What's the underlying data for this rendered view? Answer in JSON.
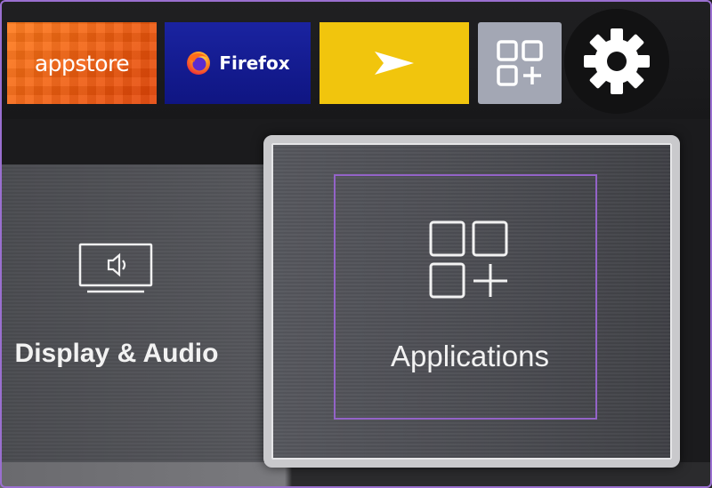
{
  "top_row": {
    "tiles": [
      {
        "label": "appstore",
        "icon": "appstore-logo"
      },
      {
        "label": "Firefox",
        "icon": "firefox-icon"
      },
      {
        "label": "",
        "icon": "send-arrow-icon"
      },
      {
        "label": "",
        "icon": "apps-grid-plus-icon"
      }
    ],
    "settings_icon": "gear-icon"
  },
  "settings": {
    "items": [
      {
        "label": "Display & Audio",
        "icon": "display-speaker-icon"
      },
      {
        "label": "Applications",
        "icon": "apps-grid-plus-icon"
      }
    ],
    "focused_index": 1
  },
  "colors": {
    "appstore": "#ff7a1a",
    "firefox": "#1a23a0",
    "send": "#f1c50d",
    "selection_outline": "#9363c7"
  }
}
